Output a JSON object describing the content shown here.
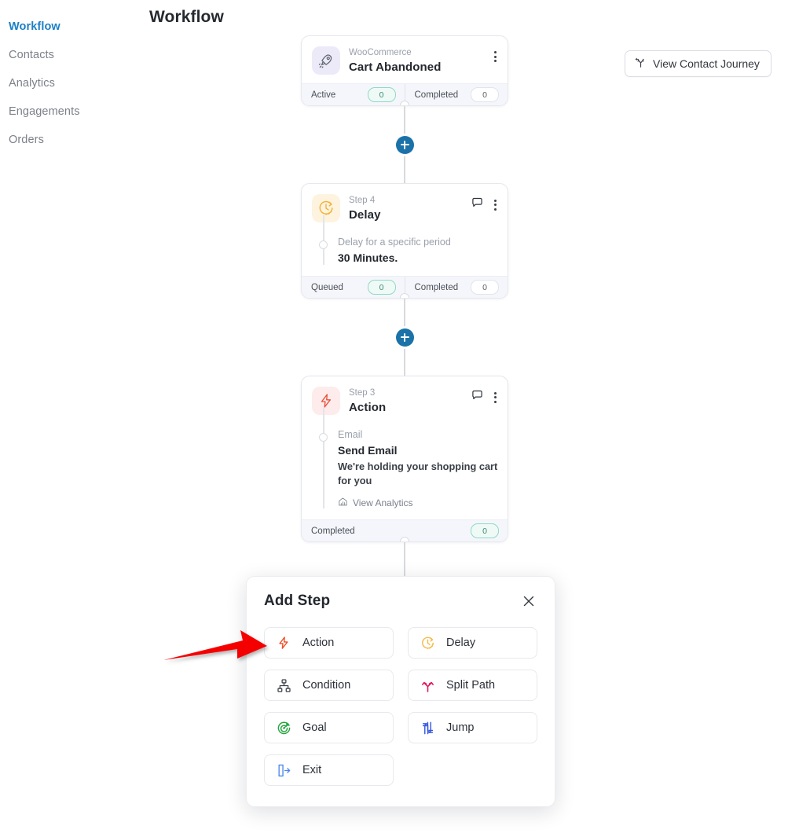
{
  "sidebar": {
    "items": [
      {
        "label": "Workflow",
        "active": true
      },
      {
        "label": "Contacts",
        "active": false
      },
      {
        "label": "Analytics",
        "active": false
      },
      {
        "label": "Engagements",
        "active": false
      },
      {
        "label": "Orders",
        "active": false
      }
    ]
  },
  "header": {
    "title": "Workflow",
    "journey_button": "View Contact Journey"
  },
  "flow": {
    "trigger": {
      "kicker": "WooCommerce",
      "title": "Cart Abandoned",
      "icon": "rocket-icon",
      "footer": [
        {
          "label": "Active",
          "count": "0",
          "style": "teal"
        },
        {
          "label": "Completed",
          "count": "0",
          "style": "plain"
        }
      ]
    },
    "delay": {
      "kicker": "Step 4",
      "title": "Delay",
      "icon": "clock-icon",
      "sub_label": "Delay for a specific period",
      "sub_value": "30 Minutes.",
      "footer": [
        {
          "label": "Queued",
          "count": "0",
          "style": "teal"
        },
        {
          "label": "Completed",
          "count": "0",
          "style": "plain"
        }
      ]
    },
    "action": {
      "kicker": "Step 3",
      "title": "Action",
      "icon": "bolt-icon",
      "sub_label": "Email",
      "sub_value": "Send Email",
      "sub_desc": "We're holding your shopping cart for you",
      "analytics_link": "View Analytics",
      "footer": [
        {
          "label": "Completed",
          "count": "0",
          "style": "teal"
        }
      ]
    }
  },
  "modal": {
    "title": "Add Step",
    "options": [
      {
        "label": "Action",
        "icon": "bolt-icon",
        "color": "#f04a23"
      },
      {
        "label": "Delay",
        "icon": "clock-icon",
        "color": "#f5b63d"
      },
      {
        "label": "Condition",
        "icon": "hierarchy-icon",
        "color": "#3c4049"
      },
      {
        "label": "Split Path",
        "icon": "split-icon",
        "color": "#e3175c"
      },
      {
        "label": "Goal",
        "icon": "target-icon",
        "color": "#25a53f"
      },
      {
        "label": "Jump",
        "icon": "jump-icon",
        "color": "#3558e0"
      },
      {
        "label": "Exit",
        "icon": "exit-icon",
        "color": "#4a86ed"
      }
    ]
  },
  "annotations": {
    "arrow_color": "#f50505",
    "highlight_ring_color": "#f50505",
    "plus_button_color": "#1a72a8"
  }
}
